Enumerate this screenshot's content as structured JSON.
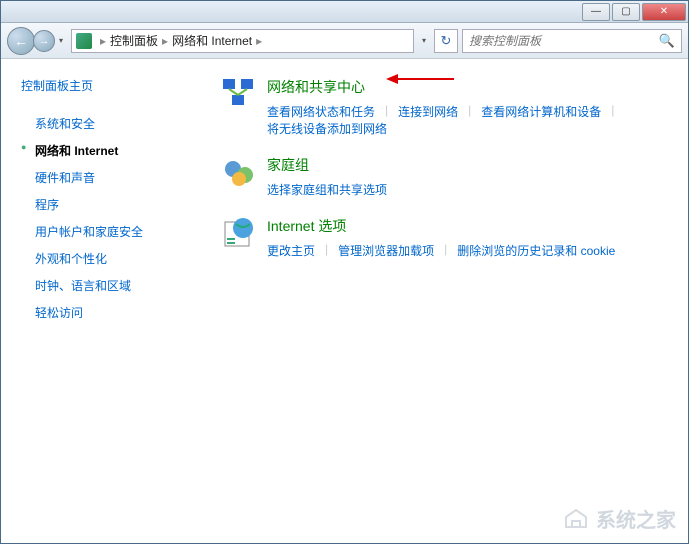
{
  "titlebar": {
    "minimize": "—",
    "maximize": "▢",
    "close": "✕"
  },
  "nav": {
    "back": "←",
    "forward": "→",
    "drop": "▾",
    "refresh": "↻"
  },
  "breadcrumb": {
    "sep0": "▸",
    "item1": "控制面板",
    "sep1": "▸",
    "item2": "网络和 Internet",
    "sep2": "▸"
  },
  "search": {
    "placeholder": "搜索控制面板",
    "icon": "🔍"
  },
  "sidebar": {
    "home": "控制面板主页",
    "items": [
      {
        "label": "系统和安全",
        "active": false
      },
      {
        "label": "网络和 Internet",
        "active": true
      },
      {
        "label": "硬件和声音",
        "active": false
      },
      {
        "label": "程序",
        "active": false
      },
      {
        "label": "用户帐户和家庭安全",
        "active": false
      },
      {
        "label": "外观和个性化",
        "active": false
      },
      {
        "label": "时钟、语言和区域",
        "active": false
      },
      {
        "label": "轻松访问",
        "active": false
      }
    ]
  },
  "main": {
    "sections": [
      {
        "title": "网络和共享中心",
        "links": [
          "查看网络状态和任务",
          "连接到网络",
          "查看网络计算机和设备",
          "将无线设备添加到网络"
        ]
      },
      {
        "title": "家庭组",
        "links": [
          "选择家庭组和共享选项"
        ]
      },
      {
        "title": "Internet 选项",
        "links": [
          "更改主页",
          "管理浏览器加载项",
          "删除浏览的历史记录和 cookie"
        ]
      }
    ]
  },
  "watermark": "系统之家"
}
